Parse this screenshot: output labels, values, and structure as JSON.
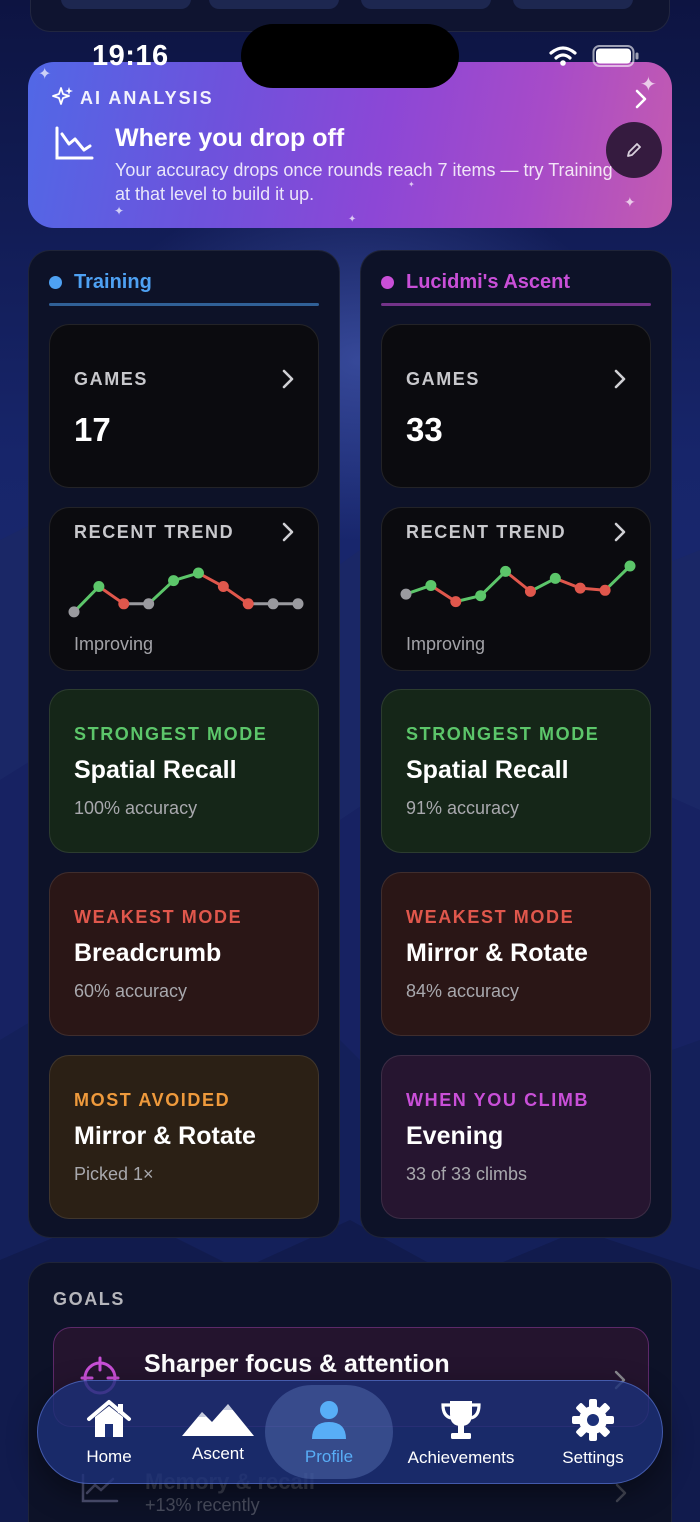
{
  "status_bar": {
    "time": "19:16"
  },
  "ai_analysis": {
    "label": "AI ANALYSIS",
    "title": "Where you drop off",
    "description": "Your accuracy drops once rounds reach 7 items — try Training at that level to build it up."
  },
  "columns": [
    {
      "title": "Training",
      "accent": "#4ea1f3",
      "games": {
        "label": "GAMES",
        "value": "17"
      },
      "trend": {
        "label": "RECENT TREND",
        "status": "Improving",
        "points": [
          0.15,
          0.62,
          0.3,
          0.3,
          0.73,
          0.87,
          0.62,
          0.3,
          0.3,
          0.3
        ]
      },
      "cards": [
        {
          "caption": "STRONGEST MODE",
          "name": "Spatial Recall",
          "sub": "100% accuracy"
        },
        {
          "caption": "WEAKEST MODE",
          "name": "Breadcrumb",
          "sub": "60% accuracy"
        },
        {
          "caption": "MOST AVOIDED",
          "name": "Mirror & Rotate",
          "sub": "Picked 1×"
        }
      ]
    },
    {
      "title": "Lucidmi's Ascent",
      "accent": "#c94fd8",
      "games": {
        "label": "GAMES",
        "value": "33"
      },
      "trend": {
        "label": "RECENT TREND",
        "status": "Improving",
        "points": [
          0.48,
          0.64,
          0.34,
          0.45,
          0.9,
          0.53,
          0.77,
          0.59,
          0.55,
          1.0
        ]
      },
      "cards": [
        {
          "caption": "STRONGEST MODE",
          "name": "Spatial Recall",
          "sub": "91% accuracy"
        },
        {
          "caption": "WEAKEST MODE",
          "name": "Mirror & Rotate",
          "sub": "84% accuracy"
        },
        {
          "caption": "WHEN YOU CLIMB",
          "name": "Evening",
          "sub": "33 of 33 climbs"
        }
      ]
    }
  ],
  "goals": {
    "title": "GOALS",
    "items": [
      {
        "name": "Sharper focus & attention"
      },
      {
        "name": "Memory & recall",
        "sub": "+13% recently"
      }
    ]
  },
  "tabbar": {
    "active": "Profile",
    "tabs": [
      {
        "label": "Home",
        "icon": "home-icon"
      },
      {
        "label": "Ascent",
        "icon": "mountains-icon"
      },
      {
        "label": "Profile",
        "icon": "person-icon"
      },
      {
        "label": "Achievements",
        "icon": "trophy-icon"
      },
      {
        "label": "Settings",
        "icon": "gear-icon"
      }
    ]
  },
  "colors": {
    "up": "#5cc66a",
    "down": "#e0574c",
    "flat": "#9a9a9f",
    "active_tab": "#58aef7"
  }
}
